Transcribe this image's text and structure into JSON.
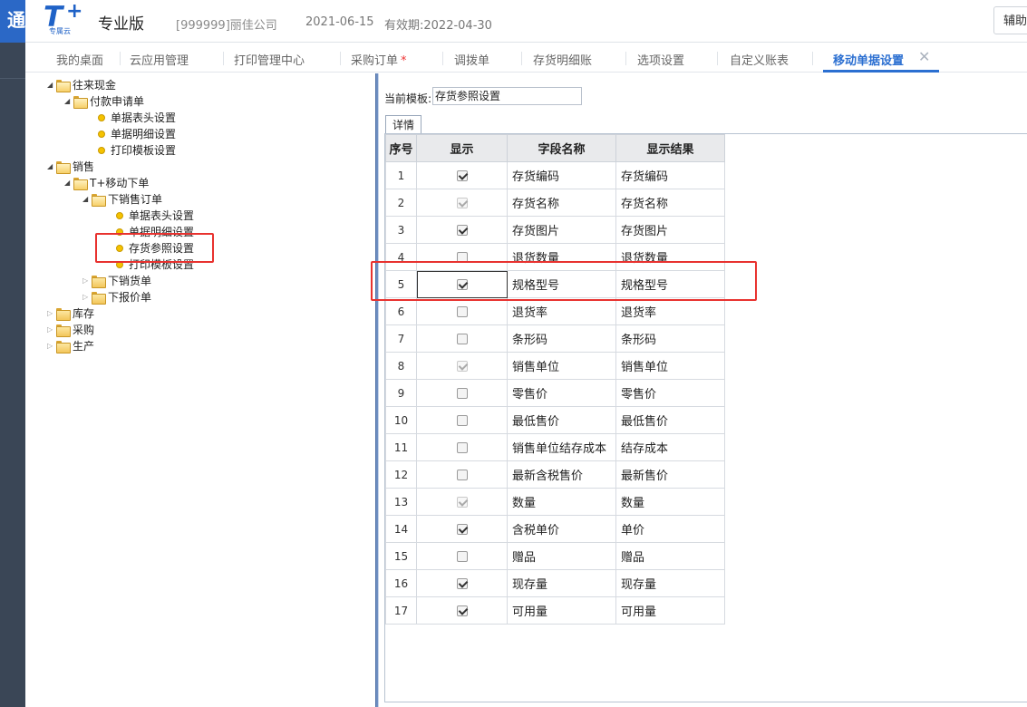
{
  "header": {
    "side_label": "通",
    "logo_letter": "T",
    "logo_plus": "+",
    "logo_sub": "专属云",
    "edition": "专业版",
    "company": "[999999]丽佳公司",
    "date": "2021-06-15",
    "expiry": "有效期:2022-04-30",
    "assist_label": "辅助"
  },
  "tabs": [
    {
      "label": "我的桌面"
    },
    {
      "label": "云应用管理"
    },
    {
      "label": "打印管理中心"
    },
    {
      "label": "采购订单",
      "mark": "*"
    },
    {
      "label": "调拨单"
    },
    {
      "label": "存货明细账"
    },
    {
      "label": "选项设置"
    },
    {
      "label": "自定义账表"
    },
    {
      "label": "移动单据设置",
      "close": "✕"
    }
  ],
  "tree": {
    "n0": "往来现金",
    "n1": "付款申请单",
    "n2": "单据表头设置",
    "n3": "单据明细设置",
    "n4": "打印模板设置",
    "n5": "销售",
    "n6": "T+移动下单",
    "n7": "下销售订单",
    "n8": "单据表头设置",
    "n9": "单据明细设置",
    "n10": "存货参照设置",
    "n11": "打印模板设置",
    "n12": "下销货单",
    "n13": "下报价单",
    "n14": "库存",
    "n15": "采购",
    "n16": "生产"
  },
  "content": {
    "template_label": "当前模板:",
    "template_value": "存货参照设置",
    "detail_tab": "详情"
  },
  "grid": {
    "headers": [
      "序号",
      "显示",
      "字段名称",
      "显示结果"
    ],
    "rows": [
      {
        "seq": "1",
        "checked": true,
        "disabled": false,
        "name": "存货编码",
        "result": "存货编码"
      },
      {
        "seq": "2",
        "checked": true,
        "disabled": true,
        "name": "存货名称",
        "result": "存货名称"
      },
      {
        "seq": "3",
        "checked": true,
        "disabled": false,
        "name": "存货图片",
        "result": "存货图片"
      },
      {
        "seq": "4",
        "checked": false,
        "disabled": false,
        "name": "退货数量",
        "result": "退货数量"
      },
      {
        "seq": "5",
        "checked": true,
        "disabled": false,
        "name": "规格型号",
        "result": "规格型号"
      },
      {
        "seq": "6",
        "checked": false,
        "disabled": false,
        "name": "退货率",
        "result": "退货率"
      },
      {
        "seq": "7",
        "checked": false,
        "disabled": false,
        "name": "条形码",
        "result": "条形码"
      },
      {
        "seq": "8",
        "checked": true,
        "disabled": true,
        "name": "销售单位",
        "result": "销售单位"
      },
      {
        "seq": "9",
        "checked": false,
        "disabled": false,
        "name": "零售价",
        "result": "零售价"
      },
      {
        "seq": "10",
        "checked": false,
        "disabled": false,
        "name": "最低售价",
        "result": "最低售价"
      },
      {
        "seq": "11",
        "checked": false,
        "disabled": false,
        "name": "销售单位结存成本",
        "result": "结存成本"
      },
      {
        "seq": "12",
        "checked": false,
        "disabled": false,
        "name": "最新含税售价",
        "result": "最新售价"
      },
      {
        "seq": "13",
        "checked": true,
        "disabled": true,
        "name": "数量",
        "result": "数量"
      },
      {
        "seq": "14",
        "checked": true,
        "disabled": false,
        "name": "含税单价",
        "result": "单价"
      },
      {
        "seq": "15",
        "checked": false,
        "disabled": false,
        "name": "赠品",
        "result": "赠品"
      },
      {
        "seq": "16",
        "checked": true,
        "disabled": false,
        "name": "现存量",
        "result": "现存量"
      },
      {
        "seq": "17",
        "checked": true,
        "disabled": false,
        "name": "可用量",
        "result": "可用量"
      }
    ],
    "selected_row": "5"
  },
  "colors": {
    "accent": "#2b6fd1",
    "highlight_box": "#e8322f",
    "selected_row": "#fff4cf"
  }
}
